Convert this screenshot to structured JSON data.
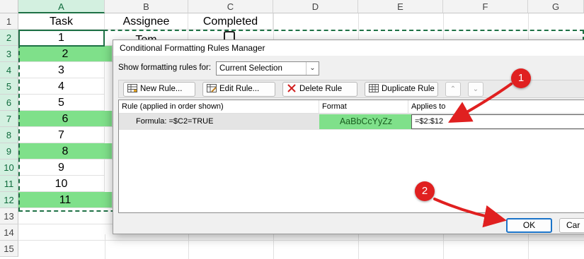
{
  "sheet": {
    "columns": [
      "A",
      "B",
      "C",
      "D",
      "E",
      "F",
      "G"
    ],
    "rows": [
      "1",
      "2",
      "3",
      "4",
      "5",
      "6",
      "7",
      "8",
      "9",
      "10",
      "11",
      "12",
      "13",
      "14",
      "15"
    ],
    "header_row": {
      "a": "Task",
      "b": "Assignee",
      "c": "Completed"
    },
    "row2_partial": "Tom",
    "tasks": [
      "1",
      "2",
      "3",
      "4",
      "5",
      "6",
      "7",
      "8",
      "9",
      "10",
      "11"
    ],
    "highlight_color": "#7fe08a",
    "selection_color": "#1e7145"
  },
  "dialog": {
    "title": "Conditional Formatting Rules Manager",
    "show_label": "Show formatting rules for:",
    "show_value": "Current Selection",
    "buttons": {
      "new_rule": "New Rule...",
      "edit_rule": "Edit Rule...",
      "delete_rule": "Delete Rule",
      "duplicate_rule": "Duplicate Rule"
    },
    "list_headers": {
      "rule": "Rule (applied in order shown)",
      "format": "Format",
      "applies_to": "Applies to"
    },
    "rule": {
      "formula": "Formula: =$C2=TRUE",
      "format_preview": "AaBbCcYyZz",
      "applies_to": "=$2:$12"
    },
    "ok": "OK",
    "cancel": "Car"
  },
  "annotations": {
    "badge1": "1",
    "badge2": "2",
    "color": "#e02020"
  }
}
